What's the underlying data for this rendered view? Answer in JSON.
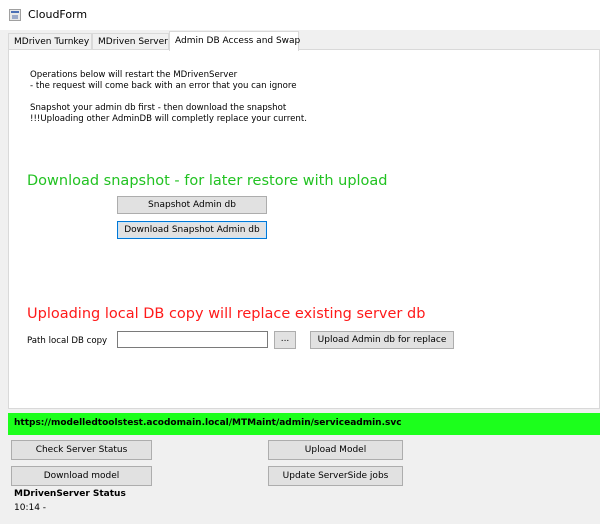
{
  "window": {
    "title": "CloudForm"
  },
  "tabs": [
    {
      "label": "MDriven Turnkey"
    },
    {
      "label": "MDriven Server"
    },
    {
      "label": "Admin DB Access and Swap"
    }
  ],
  "panel": {
    "info_lines": [
      "Operations below will restart the MDrivenServer",
      "- the request will come back with an error that you can ignore",
      "Snapshot your admin db first - then download the snapshot",
      "!!!Uploading other AdminDB will completly replace your current."
    ],
    "download_heading": "Download snapshot - for later restore with upload",
    "snapshot_button": "Snapshot Admin db",
    "download_snapshot_button": "Download Snapshot Admin db",
    "upload_heading": "Uploading local DB copy will replace existing server db",
    "path_label": "Path local DB copy",
    "path_value": "",
    "browse_button": "...",
    "upload_button": "Upload Admin db for replace"
  },
  "url": "https://modelledtoolstest.acodomain.local/MTMaint/admin/serviceadmin.svc",
  "bottom": {
    "check_status_button": "Check Server Status",
    "upload_model_button": "Upload Model",
    "download_model_button": "Download model",
    "update_jobs_button": "Update ServerSide jobs",
    "status_title": "MDrivenServer Status",
    "status_value": "10:14 -"
  },
  "colors": {
    "download_heading": "#22c222",
    "upload_heading": "#ff1a1a",
    "url_bar": "#1cff1c",
    "focus": "#0078d7"
  }
}
